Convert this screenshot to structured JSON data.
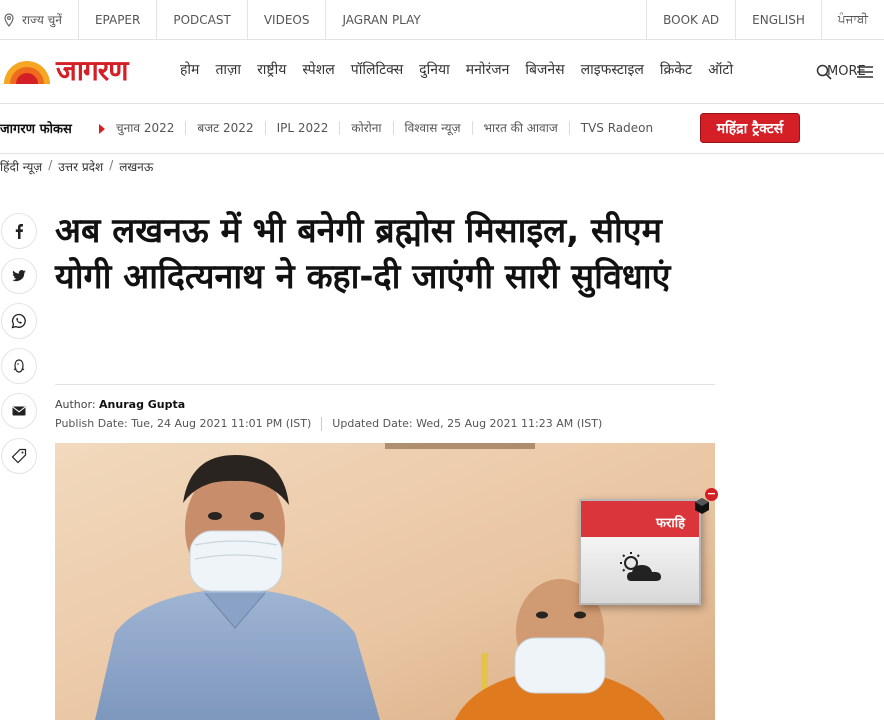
{
  "topbar": {
    "state_select": "राज्य चुनें",
    "left_links": [
      "EPAPER",
      "PODCAST",
      "VIDEOS",
      "JAGRAN PLAY"
    ],
    "right_links": [
      "BOOK AD",
      "ENGLISH",
      "ਪੰਜਾਬੀ"
    ]
  },
  "logo": {
    "text": "जागरण"
  },
  "nav": {
    "links": [
      "होम",
      "ताज़ा",
      "राष्ट्रीय",
      "स्पेशल",
      "पॉलिटिक्स",
      "दुनिया",
      "मनोरंजन",
      "बिजनेस",
      "लाइफस्टाइल",
      "क्रिकेट",
      "ऑटो"
    ],
    "more_label": "MORE"
  },
  "focus": {
    "title": "जागरण फोकस",
    "items": [
      "चुनाव 2022",
      "बजट 2022",
      "IPL 2022",
      "कोरोना",
      "विश्वास न्यूज़",
      "भारत की आवाज",
      "TVS Radeon"
    ],
    "ad_text": "महिंद्रा ट्रैक्टर्स"
  },
  "breadcrumb": [
    "हिंदी न्यूज़",
    "उत्तर प्रदेश",
    "लखनऊ"
  ],
  "breadcrumb_sep": "/",
  "share_icons": [
    "facebook-icon",
    "twitter-icon",
    "whatsapp-icon",
    "koo-icon",
    "email-icon",
    "tag-icon"
  ],
  "article": {
    "headline": "अब लखनऊ में भी बनेगी ब्रह्मोस मिसाइल, सीएम योगी आदित्यनाथ ने कहा-दी जाएंगी सारी सुविधाएं",
    "author_label": "Author:",
    "author_name": "Anurag Gupta",
    "publish_date": "Publish Date: Tue, 24 Aug 2021 11:01 PM (IST)",
    "updated_date": "Updated Date: Wed, 25 Aug 2021 11:23 AM (IST)"
  },
  "weather_widget": {
    "city": "फराहि",
    "icon": "partly-cloudy-icon",
    "close_label": "−"
  },
  "colors": {
    "brand_red": "#d51f26",
    "border": "#e4e4e4"
  }
}
